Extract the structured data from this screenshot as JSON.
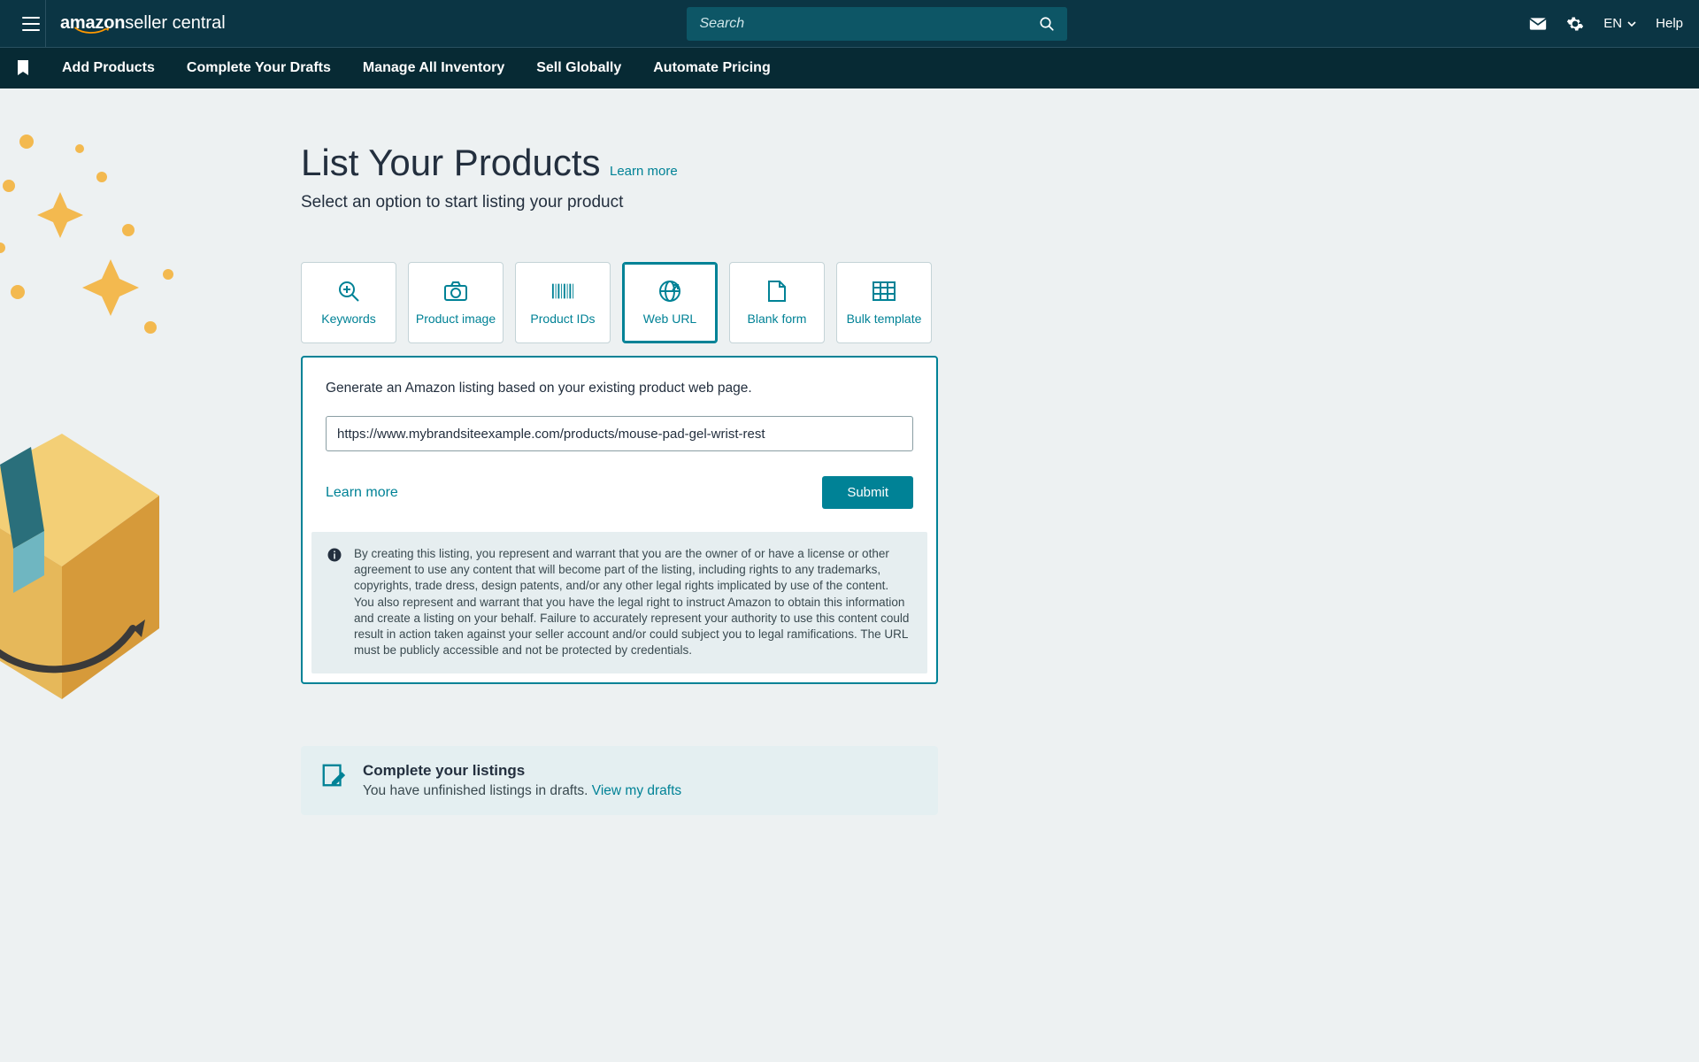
{
  "header": {
    "logo_brand": "amazon",
    "logo_suffix": "seller central",
    "search_placeholder": "Search",
    "language": "EN",
    "help": "Help"
  },
  "subnav": {
    "items": [
      "Add Products",
      "Complete Your Drafts",
      "Manage All Inventory",
      "Sell Globally",
      "Automate Pricing"
    ]
  },
  "page": {
    "title": "List Your Products",
    "learn_more": "Learn more",
    "subtitle": "Select an option to start listing your product"
  },
  "options": [
    {
      "label": "Keywords",
      "icon": "search-zoom-icon"
    },
    {
      "label": "Product image",
      "icon": "camera-icon"
    },
    {
      "label": "Product IDs",
      "icon": "barcode-icon"
    },
    {
      "label": "Web URL",
      "icon": "globe-icon",
      "active": true
    },
    {
      "label": "Blank form",
      "icon": "document-icon"
    },
    {
      "label": "Bulk template",
      "icon": "grid-icon"
    }
  ],
  "form": {
    "prompt": "Generate an Amazon listing based on your existing product web page.",
    "url_value": "https://www.mybrandsiteexample.com/products/mouse-pad-gel-wrist-rest",
    "learn_more": "Learn more",
    "submit": "Submit",
    "disclaimer": "By creating this listing, you represent and warrant that you are the owner of or have a license or other agreement to use any content that will become part of the listing, including rights to any trademarks, copyrights, trade dress, design patents, and/or any other legal rights implicated by use of the content. You also represent and warrant that you have the legal right to instruct Amazon to obtain this information and create a listing on your behalf. Failure to accurately represent your authority to use this content could result in action taken against your seller account and/or could subject you to legal ramifications. The URL must be publicly accessible and not be protected by credentials."
  },
  "complete": {
    "title": "Complete your listings",
    "sub": "You have unfinished listings in drafts. ",
    "link": "View my drafts"
  },
  "colors": {
    "teal": "#008296",
    "darknav": "#0b3544",
    "dark2": "#072a34"
  }
}
